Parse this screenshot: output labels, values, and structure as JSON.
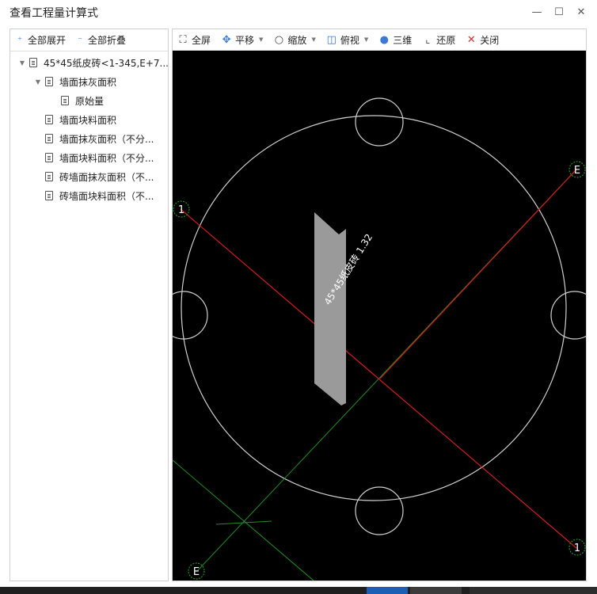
{
  "window": {
    "title": "查看工程量计算式",
    "minimize": "—",
    "maximize": "☐",
    "close": "✕"
  },
  "left_toolbar": {
    "expand_all": "全部展开",
    "collapse_all": "全部折叠"
  },
  "tree": [
    {
      "label": "45*45纸皮砖<1-345,E+7..."
    },
    {
      "label": "墙面抹灰面积"
    },
    {
      "label": "原始量"
    },
    {
      "label": "墙面块料面积"
    },
    {
      "label": "墙面抹灰面积（不分..."
    },
    {
      "label": "墙面块料面积（不分..."
    },
    {
      "label": "砖墙面抹灰面积（不..."
    },
    {
      "label": "砖墙面块料面积（不..."
    }
  ],
  "right_toolbar": {
    "fullscreen": "全屏",
    "pan": "平移",
    "zoom": "缩放",
    "view": "俯视",
    "three_d": "三维",
    "restore": "还原",
    "close": "关闭"
  },
  "drawing": {
    "element_label": "45*45纸皮砖 1.32",
    "axis_markers": [
      "1",
      "E",
      "1",
      "E"
    ],
    "colors": {
      "background": "#000000",
      "circle": "#cfcfcf",
      "red_axis": "#d81b1b",
      "green_axis": "#1f8f1f",
      "wall": "#9a9a9a"
    }
  }
}
